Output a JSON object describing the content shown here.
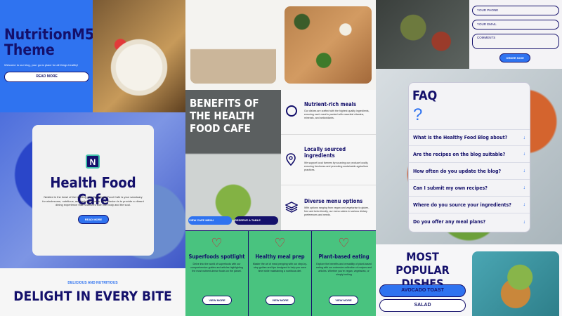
{
  "theme": {
    "title": "NutritionM5 Theme",
    "subtitle": "Welcome to our blog, your go-to place for all things healthy!",
    "read_more": "READ MORE"
  },
  "form": {
    "phone_placeholder": "YOUR PHONE",
    "email_placeholder": "YOUR EMAIL",
    "comments_placeholder": "COMMENTS",
    "order_now": "ORDER NOW"
  },
  "hero": {
    "title": "BENEFITS OF THE HEALTH FOOD CAFE",
    "view_menu": "VIEW CAFE MENU",
    "reserve": "RESERVE A TABLE"
  },
  "features": [
    {
      "icon": "globe-icon",
      "title": "Nutrient-rich meals",
      "text": "Our dishes are crafted with the highest quality ingredients, ensuring each meal is packed with essential vitamins, minerals, and antioxidants."
    },
    {
      "icon": "location-pin-icon",
      "title": "Locally sourced ingredients",
      "text": "We support local farmers by sourcing our produce locally, ensuring freshness and promoting sustainable agriculture practices."
    },
    {
      "icon": "layers-icon",
      "title": "Diverse menu options",
      "text": "With options ranging from vegan and vegetarian to gluten-free and keto-friendly, our menu caters to various dietary preferences and needs."
    }
  ],
  "faq": {
    "title": "FAQ",
    "mark": "?",
    "items": [
      "What is the Healthy Food Blog about?",
      "Are the recipes on the blog suitable?",
      "How often do you update the blog?",
      "Can I submit my own recipes?",
      "Where do you source your ingredients?",
      "Do you offer any meal plans?"
    ]
  },
  "cafe": {
    "logo": "N",
    "title": "Health Food Cafe",
    "text": "Nestled in the heart of the bustling city, The Health Food Cafe is your sanctuary for wholesome, nutritious, and delicious meals. Our mission is to provide a vibrant dining experience that nourishes both the body and the soul.",
    "read_more": "READ MORE"
  },
  "tagline": {
    "eyebrow": "DELICIOUS AND NUTRITIOUS",
    "title": "DELIGHT IN EVERY BITE"
  },
  "cards": [
    {
      "title": "Superfoods spotlight",
      "text": "Delve into the world of superfoods with our comprehensive guides and articles highlighting the most nutrient-dense foods on the planet.",
      "button": "VIEW MORE"
    },
    {
      "title": "Healthy meal prep",
      "text": "Master the art of meal prepping with our step-by-step guides and tips designed to help you save time while maintaining a nutritious diet.",
      "button": "VIEW MORE"
    },
    {
      "title": "Plant-based eating",
      "text": "Explore the benefits and versatility of plant-based eating with our extensive collection of recipes and articles. Whether you're vegan, vegetarian, or simply looking",
      "button": "VIEW MORE"
    }
  ],
  "popular": {
    "title": "MOST POPULAR DISHES",
    "dishes": [
      "AVOCADO TOAST",
      "SALAD"
    ]
  },
  "colors": {
    "blue": "#2f73f0",
    "navy": "#14106b",
    "green": "#49c37f",
    "red": "#c62a3a"
  }
}
